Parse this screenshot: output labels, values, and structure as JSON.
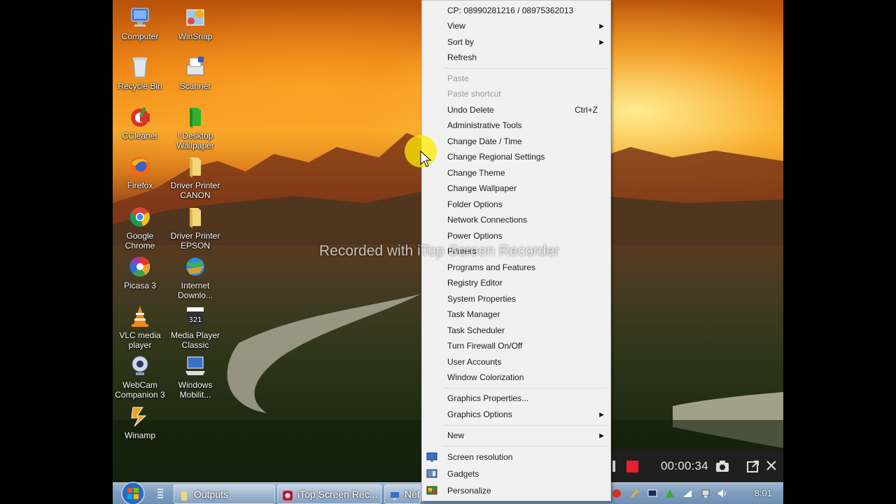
{
  "desktop": {
    "icons": [
      {
        "label": "Computer"
      },
      {
        "label": "WinSnap"
      },
      {
        "label": "Recycle Bin"
      },
      {
        "label": "Scanner"
      },
      {
        "label": "CCleaner"
      },
      {
        "label": "! Desktop Wallpaper"
      },
      {
        "label": "Firefox"
      },
      {
        "label": "Driver Printer CANON"
      },
      {
        "label": "Google Chrome"
      },
      {
        "label": "Driver Printer EPSON"
      },
      {
        "label": "Picasa 3"
      },
      {
        "label": "Internet Downlo..."
      },
      {
        "label": "VLC media player"
      },
      {
        "label": "Media Player Classic"
      },
      {
        "label": "WebCam Companion 3"
      },
      {
        "label": "Windows Mobilit..."
      },
      {
        "label": "Winamp"
      }
    ],
    "watermark": "Recorded with iTop Screen Recorder"
  },
  "context_menu": {
    "header": "CP: 08990281216 / 08975362013",
    "items_top": [
      {
        "label": "View",
        "arrow": "▶"
      },
      {
        "label": "Sort by",
        "arrow": "▶"
      },
      {
        "label": "Refresh"
      }
    ],
    "items_edit": [
      {
        "label": "Paste"
      },
      {
        "label": "Paste shortcut"
      },
      {
        "label": "Undo Delete",
        "shortcut": "Ctrl+Z"
      }
    ],
    "items_tools": [
      {
        "label": "Administrative Tools"
      },
      {
        "label": "Change Date / Time"
      },
      {
        "label": "Change Regional Settings"
      },
      {
        "label": "Change Theme"
      },
      {
        "label": "Change Wallpaper"
      },
      {
        "label": "Folder Options"
      },
      {
        "label": "Network Connections"
      },
      {
        "label": "Power Options"
      },
      {
        "label": "Printers"
      },
      {
        "label": "Programs and Features"
      },
      {
        "label": "Registry Editor"
      },
      {
        "label": "System Properties"
      },
      {
        "label": "Task Manager"
      },
      {
        "label": "Task Scheduler"
      },
      {
        "label": "Turn Firewall On/Off"
      },
      {
        "label": "User Accounts"
      },
      {
        "label": "Window Colorization"
      }
    ],
    "items_graphics": [
      {
        "label": "Graphics Properties..."
      },
      {
        "label": "Graphics Options",
        "arrow": "▶"
      }
    ],
    "items_new": [
      {
        "label": "New",
        "arrow": "▶"
      }
    ],
    "items_display": [
      {
        "label": "Screen resolution"
      },
      {
        "label": "Gadgets"
      },
      {
        "label": "Personalize"
      }
    ]
  },
  "recorder": {
    "elapsed": "00:00:34"
  },
  "taskbar": {
    "buttons": [
      {
        "label": "Outputs"
      },
      {
        "label": "iTop Screen Rec..."
      },
      {
        "label": "Net"
      }
    ],
    "clock": "8:01"
  },
  "colors": {
    "menu_bg": "#f1f1f1",
    "record_red": "#e8202a",
    "taskbar_blue": "#7f9ebf"
  }
}
